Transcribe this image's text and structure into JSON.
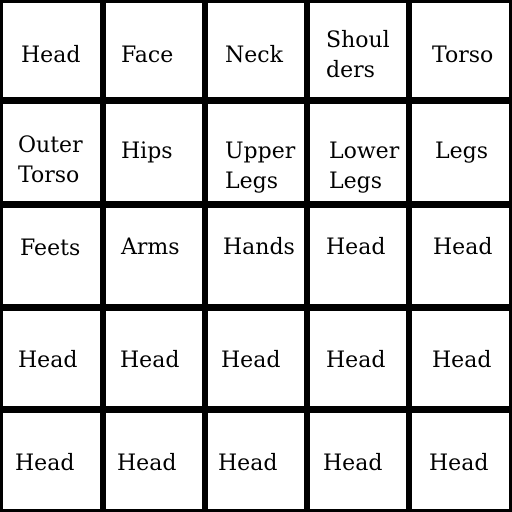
{
  "grid": {
    "rows": [
      [
        "Head",
        "Face",
        "Neck",
        "Shoul\nders",
        "Torso"
      ],
      [
        "Outer\nTorso",
        "Hips",
        "Upper\nLegs",
        "Lower\nLegs",
        "Legs"
      ],
      [
        "Feets",
        "Arms",
        "Hands",
        "Head",
        "Head"
      ],
      [
        "Head",
        "Head",
        "Head",
        "Head",
        "Head"
      ],
      [
        "Head",
        "Head",
        "Head",
        "Head",
        "Head"
      ]
    ]
  }
}
